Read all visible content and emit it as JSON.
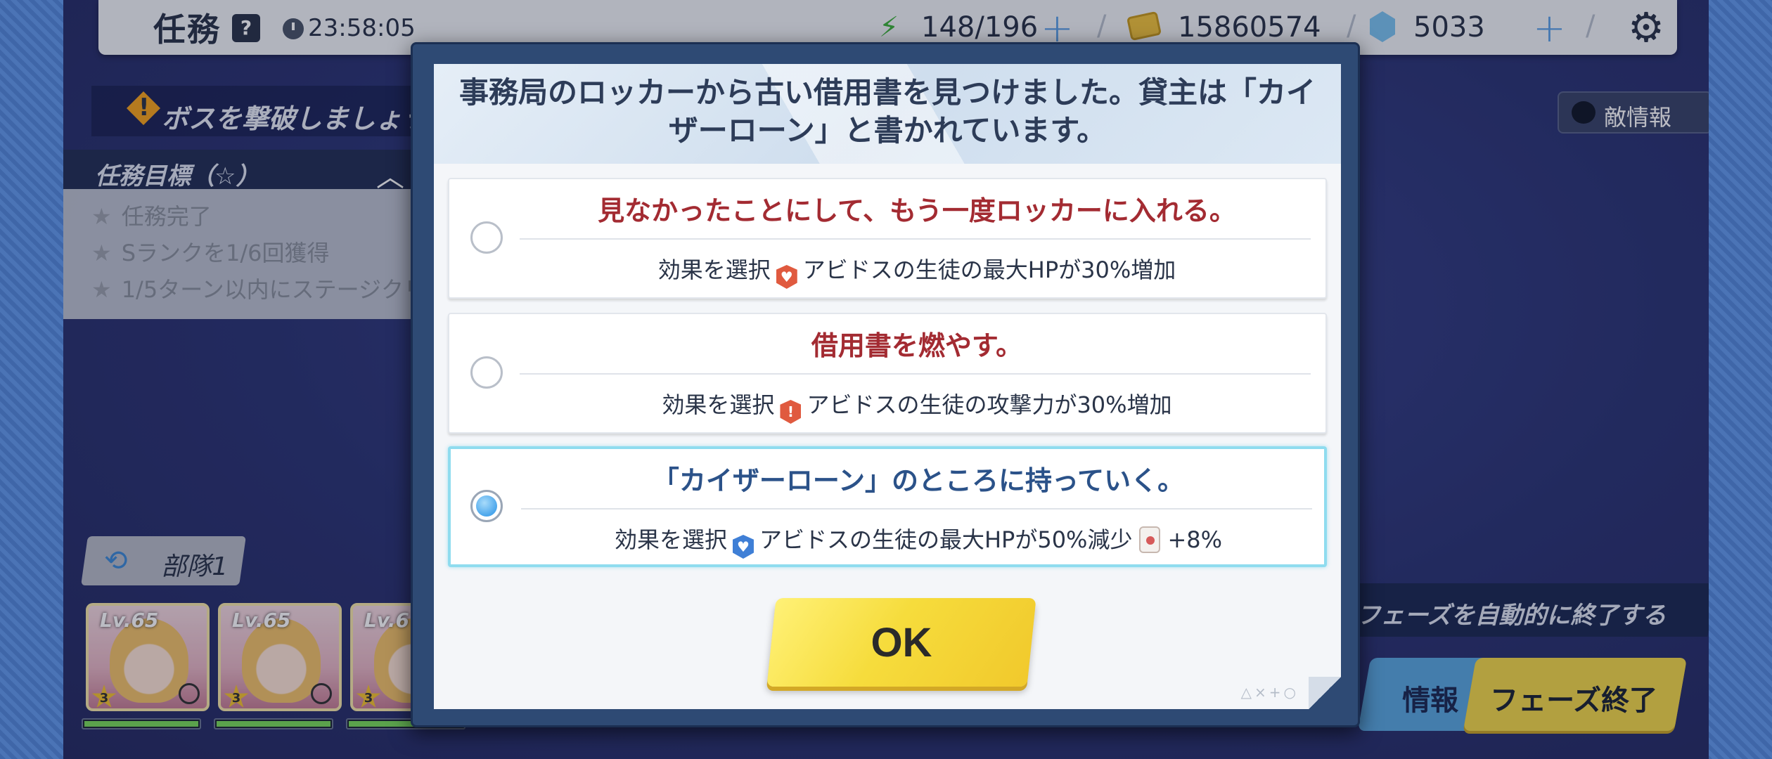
{
  "topbar": {
    "title": "任務",
    "help": "?",
    "timer": "23:58:05",
    "ap": "148/196",
    "credits": "15860574",
    "gems": "5033"
  },
  "left_panel": {
    "boss_message": "ボスを撃破しましょう！",
    "objectives_title": "任務目標（☆）",
    "objectives": [
      "任務完了",
      "Sランクを1/6回獲得",
      "1/5ターン以内にステージクリ"
    ]
  },
  "enemy_info_label": "敵情報",
  "squad": {
    "label": "部隊1",
    "characters": [
      {
        "level": "Lv.65",
        "stars": "3",
        "hp_fraction": 1.0
      },
      {
        "level": "Lv.65",
        "stars": "3",
        "hp_fraction": 1.0
      },
      {
        "level": "Lv.6",
        "stars": "3",
        "hp_fraction": 1.0
      }
    ]
  },
  "bottom_right": {
    "auto_phase": "フェーズを自動的に終了する",
    "info_label": "情報",
    "phase_end_label": "フェーズ終了"
  },
  "dialog": {
    "title": "事務局のロッカーから古い借用書を見つけました。貸主は「カイザーローン」と書かれています。",
    "choices": [
      {
        "title": "見なかったことにして、もう一度ロッカーに入れる。",
        "effect_prefix": "効果を選択",
        "effect_text": "アビドスの生徒の最大HPが30%増加",
        "icon": "heart-up-icon",
        "selected": false
      },
      {
        "title": "借用書を燃やす。",
        "effect_prefix": "効果を選択",
        "effect_text": "アビドスの生徒の攻撃力が30%増加",
        "icon": "attack-up-icon",
        "selected": false
      },
      {
        "title": "「カイザーローン」のところに持っていく。",
        "effect_prefix": "効果を選択",
        "effect_text": "アビドスの生徒の最大HPが50%減少",
        "icon": "heart-down-icon",
        "bonus": "+8%",
        "selected": true
      }
    ],
    "ok_label": "OK",
    "corner_deco": "△×+○"
  },
  "colors": {
    "choice_red": "#a32b32",
    "choice_blue": "#2b5289",
    "ok_yellow": "#f6dc3c",
    "dialog_frame": "#2e4a74"
  }
}
